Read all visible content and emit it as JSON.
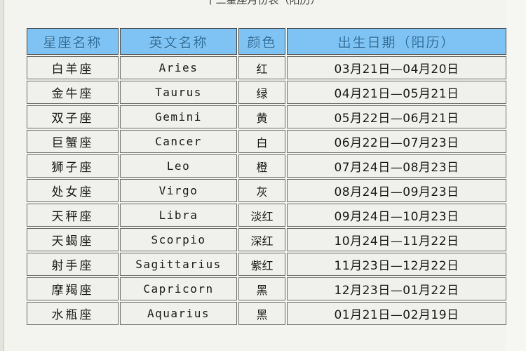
{
  "caption": "十二星座月份表（阳历）",
  "table": {
    "headers": [
      "星座名称",
      "英文名称",
      "颜色",
      "出生日期（阳历）"
    ],
    "rows": [
      {
        "name": "白羊座",
        "en": "Aries",
        "color": "红",
        "date": "03月21日—04月20日"
      },
      {
        "name": "金牛座",
        "en": "Taurus",
        "color": "绿",
        "date": "04月21日—05月21日"
      },
      {
        "name": "双子座",
        "en": "Gemini",
        "color": "黄",
        "date": "05月22日—06月21日"
      },
      {
        "name": "巨蟹座",
        "en": "Cancer",
        "color": "白",
        "date": "06月22日—07月23日"
      },
      {
        "name": "狮子座",
        "en": "Leo",
        "color": "橙",
        "date": "07月24日—08月23日"
      },
      {
        "name": "处女座",
        "en": "Virgo",
        "color": "灰",
        "date": "08月24日—09月23日"
      },
      {
        "name": "天秤座",
        "en": "Libra",
        "color": "淡红",
        "date": "09月24日—10月23日"
      },
      {
        "name": "天蝎座",
        "en": "Scorpio",
        "color": "深红",
        "date": "10月24日—11月22日"
      },
      {
        "name": "射手座",
        "en": "Sagittarius",
        "color": "紫红",
        "date": "11月23日—12月22日"
      },
      {
        "name": "摩羯座",
        "en": "Capricorn",
        "color": "黑",
        "date": "12月23日—01月22日"
      },
      {
        "name": "水瓶座",
        "en": "Aquarius",
        "color": "黑",
        "date": "01月21日—02月19日"
      }
    ]
  },
  "colors": {
    "header_background": "#7fc2f2",
    "header_text": "#2f6f9e",
    "cell_background": "#eeeeea",
    "cell_text": "#1b1b1b",
    "border": "#6d6d6d",
    "page_background": "#f3f3ef"
  }
}
